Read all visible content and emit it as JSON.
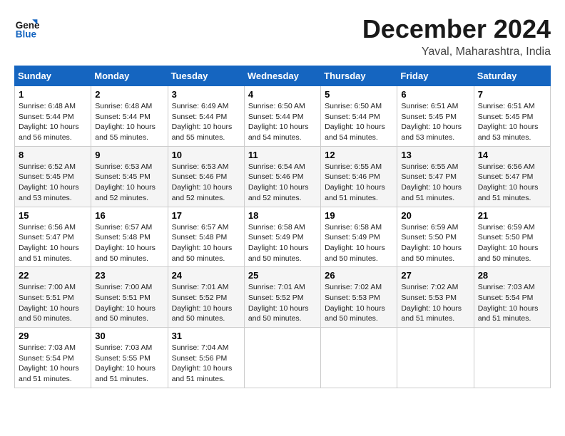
{
  "logo": {
    "line1": "General",
    "line2": "Blue"
  },
  "title": "December 2024",
  "location": "Yaval, Maharashtra, India",
  "weekdays": [
    "Sunday",
    "Monday",
    "Tuesday",
    "Wednesday",
    "Thursday",
    "Friday",
    "Saturday"
  ],
  "weeks": [
    [
      {
        "day": 1,
        "sunrise": "6:48 AM",
        "sunset": "5:44 PM",
        "daylight": "10 hours and 56 minutes."
      },
      {
        "day": 2,
        "sunrise": "6:48 AM",
        "sunset": "5:44 PM",
        "daylight": "10 hours and 55 minutes."
      },
      {
        "day": 3,
        "sunrise": "6:49 AM",
        "sunset": "5:44 PM",
        "daylight": "10 hours and 55 minutes."
      },
      {
        "day": 4,
        "sunrise": "6:50 AM",
        "sunset": "5:44 PM",
        "daylight": "10 hours and 54 minutes."
      },
      {
        "day": 5,
        "sunrise": "6:50 AM",
        "sunset": "5:44 PM",
        "daylight": "10 hours and 54 minutes."
      },
      {
        "day": 6,
        "sunrise": "6:51 AM",
        "sunset": "5:45 PM",
        "daylight": "10 hours and 53 minutes."
      },
      {
        "day": 7,
        "sunrise": "6:51 AM",
        "sunset": "5:45 PM",
        "daylight": "10 hours and 53 minutes."
      }
    ],
    [
      {
        "day": 8,
        "sunrise": "6:52 AM",
        "sunset": "5:45 PM",
        "daylight": "10 hours and 53 minutes."
      },
      {
        "day": 9,
        "sunrise": "6:53 AM",
        "sunset": "5:45 PM",
        "daylight": "10 hours and 52 minutes."
      },
      {
        "day": 10,
        "sunrise": "6:53 AM",
        "sunset": "5:46 PM",
        "daylight": "10 hours and 52 minutes."
      },
      {
        "day": 11,
        "sunrise": "6:54 AM",
        "sunset": "5:46 PM",
        "daylight": "10 hours and 52 minutes."
      },
      {
        "day": 12,
        "sunrise": "6:55 AM",
        "sunset": "5:46 PM",
        "daylight": "10 hours and 51 minutes."
      },
      {
        "day": 13,
        "sunrise": "6:55 AM",
        "sunset": "5:47 PM",
        "daylight": "10 hours and 51 minutes."
      },
      {
        "day": 14,
        "sunrise": "6:56 AM",
        "sunset": "5:47 PM",
        "daylight": "10 hours and 51 minutes."
      }
    ],
    [
      {
        "day": 15,
        "sunrise": "6:56 AM",
        "sunset": "5:47 PM",
        "daylight": "10 hours and 51 minutes."
      },
      {
        "day": 16,
        "sunrise": "6:57 AM",
        "sunset": "5:48 PM",
        "daylight": "10 hours and 50 minutes."
      },
      {
        "day": 17,
        "sunrise": "6:57 AM",
        "sunset": "5:48 PM",
        "daylight": "10 hours and 50 minutes."
      },
      {
        "day": 18,
        "sunrise": "6:58 AM",
        "sunset": "5:49 PM",
        "daylight": "10 hours and 50 minutes."
      },
      {
        "day": 19,
        "sunrise": "6:58 AM",
        "sunset": "5:49 PM",
        "daylight": "10 hours and 50 minutes."
      },
      {
        "day": 20,
        "sunrise": "6:59 AM",
        "sunset": "5:50 PM",
        "daylight": "10 hours and 50 minutes."
      },
      {
        "day": 21,
        "sunrise": "6:59 AM",
        "sunset": "5:50 PM",
        "daylight": "10 hours and 50 minutes."
      }
    ],
    [
      {
        "day": 22,
        "sunrise": "7:00 AM",
        "sunset": "5:51 PM",
        "daylight": "10 hours and 50 minutes."
      },
      {
        "day": 23,
        "sunrise": "7:00 AM",
        "sunset": "5:51 PM",
        "daylight": "10 hours and 50 minutes."
      },
      {
        "day": 24,
        "sunrise": "7:01 AM",
        "sunset": "5:52 PM",
        "daylight": "10 hours and 50 minutes."
      },
      {
        "day": 25,
        "sunrise": "7:01 AM",
        "sunset": "5:52 PM",
        "daylight": "10 hours and 50 minutes."
      },
      {
        "day": 26,
        "sunrise": "7:02 AM",
        "sunset": "5:53 PM",
        "daylight": "10 hours and 50 minutes."
      },
      {
        "day": 27,
        "sunrise": "7:02 AM",
        "sunset": "5:53 PM",
        "daylight": "10 hours and 51 minutes."
      },
      {
        "day": 28,
        "sunrise": "7:03 AM",
        "sunset": "5:54 PM",
        "daylight": "10 hours and 51 minutes."
      }
    ],
    [
      {
        "day": 29,
        "sunrise": "7:03 AM",
        "sunset": "5:54 PM",
        "daylight": "10 hours and 51 minutes."
      },
      {
        "day": 30,
        "sunrise": "7:03 AM",
        "sunset": "5:55 PM",
        "daylight": "10 hours and 51 minutes."
      },
      {
        "day": 31,
        "sunrise": "7:04 AM",
        "sunset": "5:56 PM",
        "daylight": "10 hours and 51 minutes."
      },
      null,
      null,
      null,
      null
    ]
  ]
}
